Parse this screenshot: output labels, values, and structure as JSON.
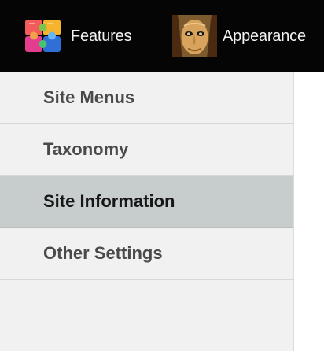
{
  "topnav": {
    "items": [
      {
        "label": "Features",
        "icon": "puzzle-icon"
      },
      {
        "label": "Appearance",
        "icon": "portrait-icon"
      }
    ]
  },
  "sidebar": {
    "items": [
      {
        "label": "Site Menus",
        "active": false
      },
      {
        "label": "Taxonomy",
        "active": false
      },
      {
        "label": "Site Information",
        "active": true
      },
      {
        "label": "Other Settings",
        "active": false
      }
    ]
  },
  "colors": {
    "topbar_bg": "#050505",
    "sidebar_bg": "#f1f1f1",
    "active_item_bg": "#c7cccc"
  }
}
